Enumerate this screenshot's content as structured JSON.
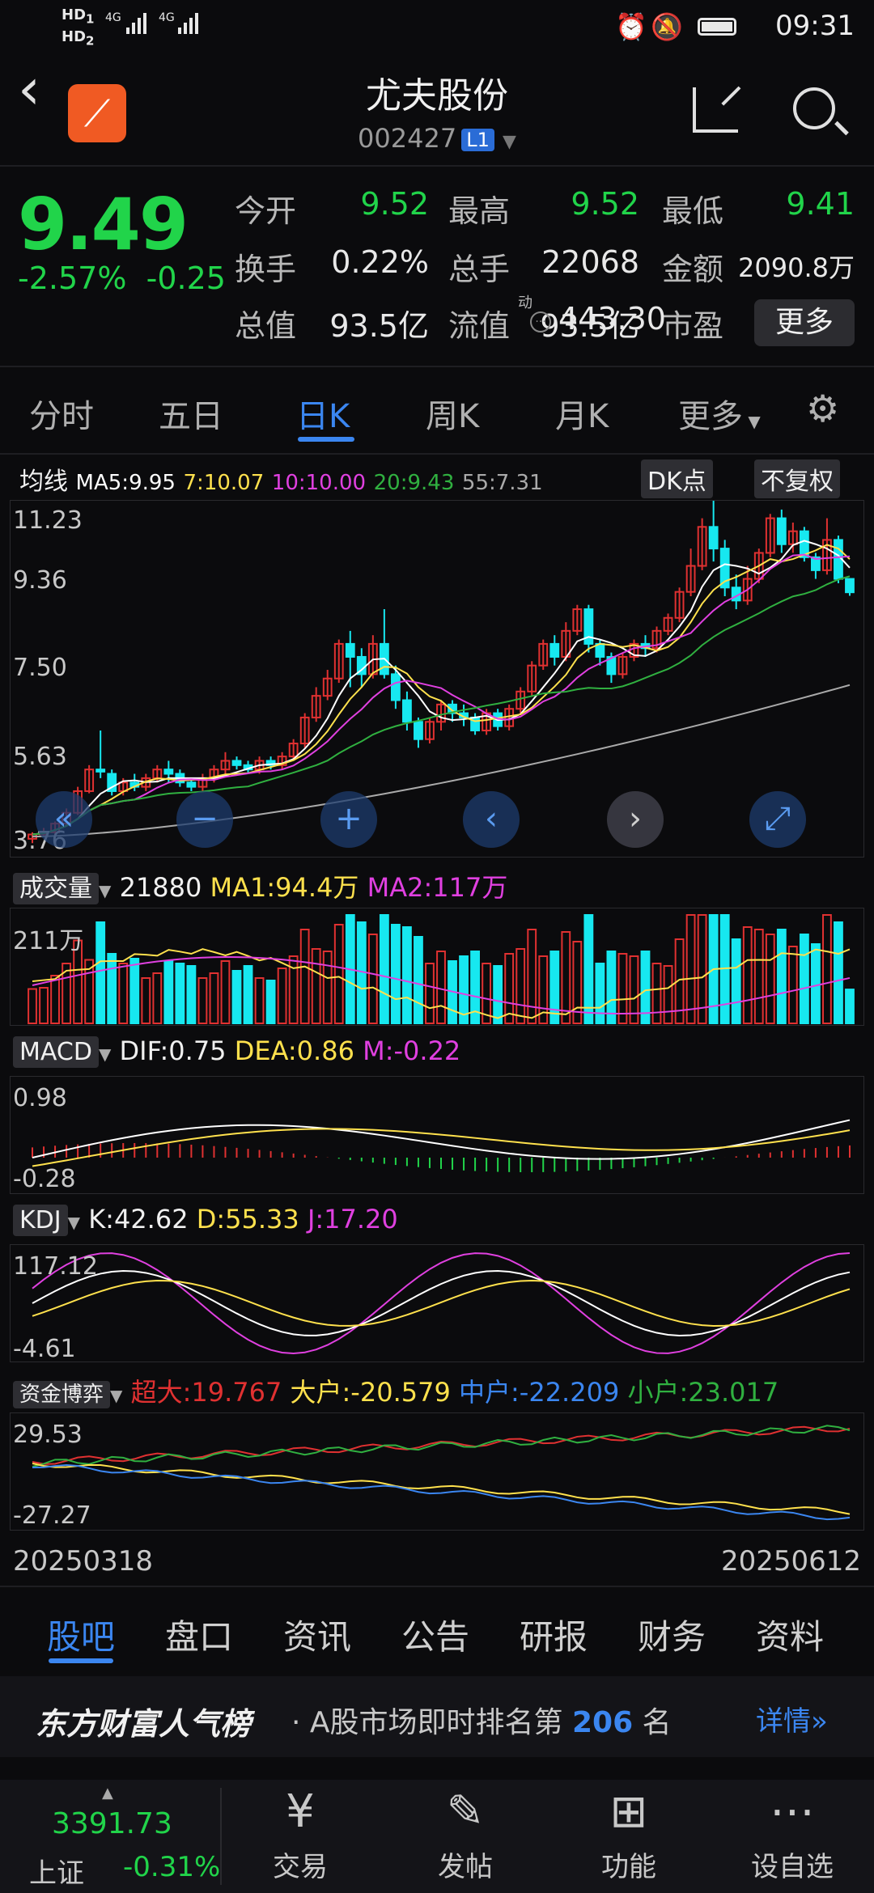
{
  "status": {
    "sim": "HD",
    "sim1": "1",
    "sim2": "2",
    "net1": "4G",
    "net2": "4G",
    "time": "09:31"
  },
  "header": {
    "title": "尤夫股份",
    "code": "002427",
    "level": "L1"
  },
  "quote": {
    "price": "9.49",
    "change_pct": "-2.57%",
    "change": "-0.25",
    "fields": [
      {
        "label": "今开",
        "value": "9.52",
        "green": true
      },
      {
        "label": "最高",
        "value": "9.52",
        "green": true
      },
      {
        "label": "最低",
        "value": "9.41",
        "green": true
      },
      {
        "label": "换手",
        "value": "0.22%",
        "green": false
      },
      {
        "label": "总手",
        "value": "22068",
        "green": false
      },
      {
        "label": "金额",
        "value": "2090.8万",
        "green": false
      },
      {
        "label": "总值",
        "value": "93.5亿",
        "green": false
      },
      {
        "label": "流值",
        "value": "93.5亿",
        "green": false
      },
      {
        "label": "市盈",
        "value": "443.30",
        "green": false
      }
    ],
    "pe_sup": "动",
    "more": "更多"
  },
  "periods": [
    "分时",
    "五日",
    "日K",
    "周K",
    "月K",
    "更多"
  ],
  "ma_legend": {
    "title": "均线",
    "ma5": "MA5:9.95",
    "ma7": "7:10.07",
    "ma10": "10:10.00",
    "ma20": "20:9.43",
    "ma55": "55:7.31",
    "dk": "DK点",
    "fq": "不复权"
  },
  "kline_yticks": [
    "11.23",
    "9.36",
    "7.50",
    "5.63",
    "3.76"
  ],
  "volume": {
    "tag": "成交量",
    "value": "21880",
    "ma1": "MA1:94.4万",
    "ma2": "MA2:117万",
    "ytick": "211万"
  },
  "macd": {
    "tag": "MACD",
    "dif": "DIF:0.75",
    "dea": "DEA:0.86",
    "m": "M:-0.22",
    "yticks": [
      "0.98",
      "-0.28"
    ]
  },
  "kdj": {
    "tag": "KDJ",
    "k": "K:42.62",
    "d": "D:55.33",
    "j": "J:17.20",
    "yticks": [
      "117.12",
      "-4.61"
    ]
  },
  "fund": {
    "tag": "资金博弈",
    "super": "超大:19.767",
    "big": "大户:-20.579",
    "mid": "中户:-22.209",
    "small": "小户:23.017",
    "yticks": [
      "29.53",
      "-27.27"
    ]
  },
  "dates": {
    "start": "20250318",
    "end": "20250612"
  },
  "bottom_tabs": [
    "股吧",
    "盘口",
    "资讯",
    "公告",
    "研报",
    "财务",
    "资料"
  ],
  "banner": {
    "brand": "东方财富人气榜",
    "text": "· A股市场即时排名第",
    "rank": "206",
    "suffix": "名",
    "link": "详情"
  },
  "dock": {
    "index_value": "3391.73",
    "index_name": "上证",
    "index_chg": "-0.31%",
    "items": [
      "交易",
      "发帖",
      "功能",
      "设自选"
    ]
  },
  "colors": {
    "up": "#e03131",
    "down": "#17e8f0",
    "green": "#21d44a",
    "accent": "#3b86f0",
    "ma5": "#ffffff",
    "ma10": "#ffe14d",
    "ma20": "#e040e0",
    "ma55": "#30b040"
  },
  "chart_data": {
    "type": "candlestick",
    "ylim": [
      3.76,
      11.23
    ],
    "candles": [
      [
        3.8,
        3.9,
        3.7,
        3.95
      ],
      [
        3.9,
        3.95,
        3.85,
        4.05
      ],
      [
        3.95,
        4.15,
        3.9,
        4.2
      ],
      [
        4.15,
        4.4,
        4.1,
        4.5
      ],
      [
        4.4,
        4.9,
        4.35,
        5.0
      ],
      [
        4.9,
        5.4,
        4.85,
        5.5
      ],
      [
        5.4,
        5.35,
        5.2,
        6.3
      ],
      [
        5.3,
        4.9,
        4.8,
        5.4
      ],
      [
        4.9,
        5.1,
        4.8,
        5.2
      ],
      [
        5.1,
        5.0,
        4.9,
        5.3
      ],
      [
        5.0,
        5.2,
        4.9,
        5.3
      ],
      [
        5.2,
        5.4,
        5.1,
        5.5
      ],
      [
        5.4,
        5.3,
        5.1,
        5.6
      ],
      [
        5.3,
        5.1,
        5.0,
        5.4
      ],
      [
        5.1,
        5.0,
        4.9,
        5.2
      ],
      [
        5.0,
        5.2,
        4.9,
        5.3
      ],
      [
        5.2,
        5.4,
        5.1,
        5.5
      ],
      [
        5.4,
        5.6,
        5.3,
        5.8
      ],
      [
        5.6,
        5.5,
        5.4,
        5.7
      ],
      [
        5.5,
        5.4,
        5.3,
        5.6
      ],
      [
        5.4,
        5.6,
        5.3,
        5.7
      ],
      [
        5.6,
        5.5,
        5.4,
        5.7
      ],
      [
        5.5,
        5.7,
        5.4,
        5.8
      ],
      [
        5.7,
        6.0,
        5.6,
        6.1
      ],
      [
        6.0,
        6.6,
        5.9,
        6.7
      ],
      [
        6.6,
        7.1,
        6.5,
        7.3
      ],
      [
        7.1,
        7.5,
        7.0,
        7.7
      ],
      [
        7.5,
        8.3,
        7.4,
        8.4
      ],
      [
        8.3,
        8.0,
        7.3,
        8.6
      ],
      [
        8.0,
        7.6,
        7.3,
        8.2
      ],
      [
        7.6,
        8.3,
        7.5,
        8.5
      ],
      [
        8.3,
        7.6,
        7.5,
        9.1
      ],
      [
        7.6,
        7.0,
        6.8,
        7.8
      ],
      [
        7.0,
        6.5,
        6.3,
        7.2
      ],
      [
        6.5,
        6.1,
        5.9,
        6.6
      ],
      [
        6.1,
        6.5,
        6.0,
        6.6
      ],
      [
        6.5,
        6.9,
        6.3,
        7.0
      ],
      [
        6.9,
        6.7,
        6.5,
        7.0
      ],
      [
        6.7,
        6.6,
        6.4,
        6.9
      ],
      [
        6.6,
        6.3,
        6.2,
        6.7
      ],
      [
        6.3,
        6.7,
        6.2,
        6.8
      ],
      [
        6.7,
        6.4,
        6.3,
        6.8
      ],
      [
        6.4,
        6.8,
        6.3,
        6.9
      ],
      [
        6.8,
        7.2,
        6.7,
        7.3
      ],
      [
        7.2,
        7.8,
        7.1,
        7.9
      ],
      [
        7.8,
        8.3,
        7.7,
        8.4
      ],
      [
        8.3,
        8.0,
        7.8,
        8.5
      ],
      [
        8.0,
        8.6,
        7.9,
        8.8
      ],
      [
        8.6,
        9.1,
        8.5,
        9.2
      ],
      [
        9.1,
        8.3,
        8.1,
        9.2
      ],
      [
        8.3,
        8.0,
        7.8,
        8.4
      ],
      [
        8.0,
        7.6,
        7.4,
        8.1
      ],
      [
        7.6,
        8.0,
        7.5,
        8.1
      ],
      [
        8.0,
        8.3,
        7.9,
        8.4
      ],
      [
        8.3,
        8.2,
        8.0,
        8.5
      ],
      [
        8.2,
        8.6,
        8.1,
        8.7
      ],
      [
        8.6,
        8.9,
        8.5,
        9.0
      ],
      [
        8.9,
        9.5,
        8.8,
        9.6
      ],
      [
        9.5,
        10.1,
        9.4,
        10.5
      ],
      [
        10.1,
        11.0,
        10.0,
        11.2
      ],
      [
        11.0,
        10.5,
        10.2,
        11.7
      ],
      [
        10.5,
        9.6,
        9.4,
        10.7
      ],
      [
        9.6,
        9.3,
        9.1,
        9.9
      ],
      [
        9.3,
        9.8,
        9.2,
        10.1
      ],
      [
        9.8,
        10.4,
        9.7,
        10.5
      ],
      [
        10.4,
        11.2,
        10.3,
        11.3
      ],
      [
        11.2,
        10.6,
        10.4,
        11.4
      ],
      [
        10.6,
        10.9,
        10.4,
        11.1
      ],
      [
        10.9,
        10.3,
        10.2,
        11.0
      ],
      [
        10.3,
        10.0,
        9.8,
        10.4
      ],
      [
        10.0,
        10.7,
        9.9,
        11.2
      ],
      [
        10.7,
        9.8,
        9.7,
        10.8
      ],
      [
        9.8,
        9.49,
        9.41,
        9.52
      ]
    ]
  }
}
